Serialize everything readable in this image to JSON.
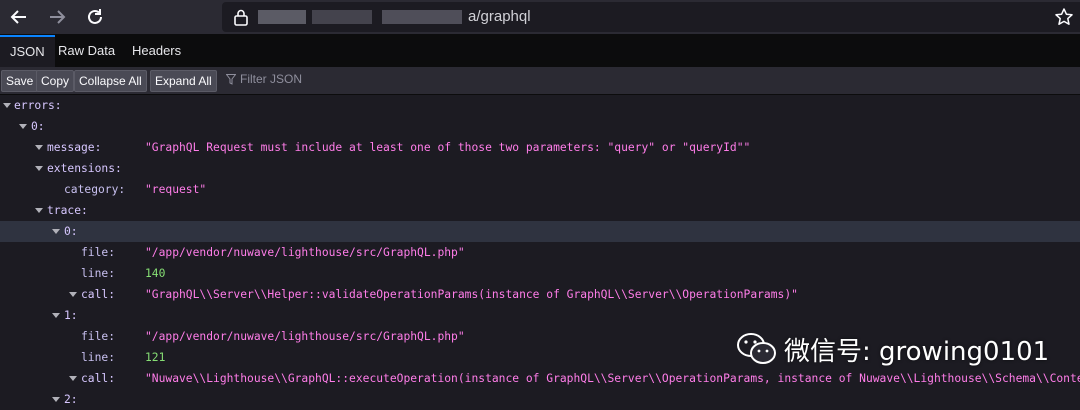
{
  "browser": {
    "back_icon": "arrow-left-icon",
    "forward_icon": "arrow-right-icon",
    "reload_icon": "reload-icon",
    "url_suffix": "a/graphql",
    "bookmark_icon": "star-icon"
  },
  "viewer": {
    "tabs": [
      "JSON",
      "Raw Data",
      "Headers"
    ],
    "buttons": {
      "save": "Save",
      "copy": "Copy",
      "collapse": "Collapse All",
      "expand": "Expand All"
    },
    "filter_placeholder": "Filter JSON",
    "accent": "#0a84ff"
  },
  "tree": {
    "errors_key": "errors:",
    "idx0": "0:",
    "message_key": "message:",
    "message_val": "\"GraphQL Request must include at least one of those two parameters: \"query\" or \"queryId\"\"",
    "extensions_key": "extensions:",
    "category_key": "category:",
    "category_val": "\"request\"",
    "trace_key": "trace:",
    "t0_key": "0:",
    "t0_file_key": "file:",
    "t0_file_val": "\"/app/vendor/nuwave/lighthouse/src/GraphQL.php\"",
    "t0_line_key": "line:",
    "t0_line_val": "140",
    "t0_call_key": "call:",
    "t0_call_val": "\"GraphQL\\\\Server\\\\Helper::validateOperationParams(instance of GraphQL\\\\Server\\\\OperationParams)\"",
    "t1_key": "1:",
    "t1_file_key": "file:",
    "t1_file_val": "\"/app/vendor/nuwave/lighthouse/src/GraphQL.php\"",
    "t1_line_key": "line:",
    "t1_line_val": "121",
    "t1_call_key": "call:",
    "t1_call_val": "\"Nuwave\\\\Lighthouse\\\\GraphQL::executeOperation(instance of GraphQL\\\\Server\\\\OperationParams, instance of Nuwave\\\\Lighthouse\\\\Schema\\\\Context)\"",
    "t2_key": "2:"
  },
  "watermark": {
    "text": "微信号: growing0101",
    "icon": "wechat-logo"
  }
}
